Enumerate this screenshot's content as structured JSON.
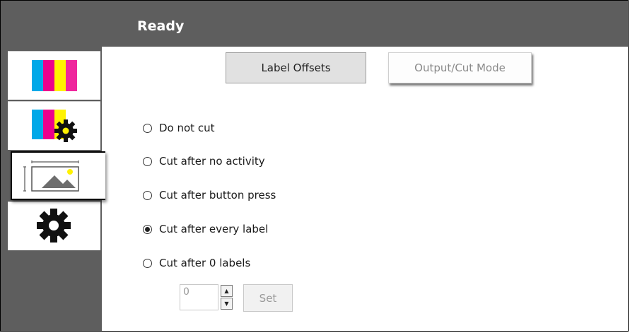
{
  "header": {
    "title": "Ready"
  },
  "sidebar": {
    "tabs": [
      {
        "icon": "color-bars-icon"
      },
      {
        "icon": "color-bars-gear-icon"
      },
      {
        "icon": "label-image-icon"
      },
      {
        "icon": "gear-icon"
      }
    ]
  },
  "tabs": {
    "label_offsets": "Label Offsets",
    "output_cut_mode": "Output/Cut Mode"
  },
  "cut_options": [
    {
      "label": "Do not cut",
      "checked": false
    },
    {
      "label": "Cut after no activity",
      "checked": false
    },
    {
      "label": "Cut after button press",
      "checked": false
    },
    {
      "label": "Cut after every label",
      "checked": true
    },
    {
      "label": "Cut after 0 labels",
      "checked": false
    }
  ],
  "label_count": {
    "value": "0",
    "set_label": "Set"
  },
  "colors": {
    "header_bg": "#5e5e5e",
    "cyan": "#00a8e8",
    "magenta": "#ec008c",
    "yellow": "#fff200"
  }
}
